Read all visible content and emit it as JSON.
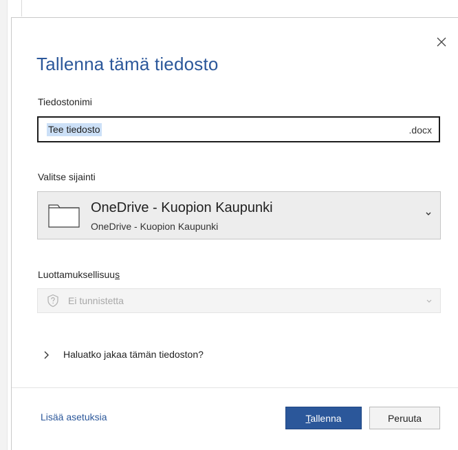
{
  "dialog": {
    "title": "Tallenna tämä tiedosto",
    "close_icon": "close-icon"
  },
  "filename": {
    "label": "Tiedostonimi",
    "value": "Tee tiedosto",
    "extension": ".docx"
  },
  "location": {
    "label": "Valitse sijainti",
    "name": "OneDrive - Kuopion Kaupunki",
    "sub": "OneDrive - Kuopion Kaupunki",
    "icon": "folder-icon"
  },
  "sensitivity": {
    "label_main": "Luottamuksellisuu",
    "label_mnemonic": "s",
    "value": "Ei tunnistetta",
    "icon": "shield-question-icon"
  },
  "share": {
    "label": "Haluatko jakaa tämän tiedoston?"
  },
  "footer": {
    "more_options": "Lisää asetuksia",
    "save_mnemonic": "T",
    "save_rest": "allenna",
    "cancel": "Peruuta"
  },
  "colors": {
    "accent": "#2b579a",
    "selection": "#cce0f7"
  }
}
